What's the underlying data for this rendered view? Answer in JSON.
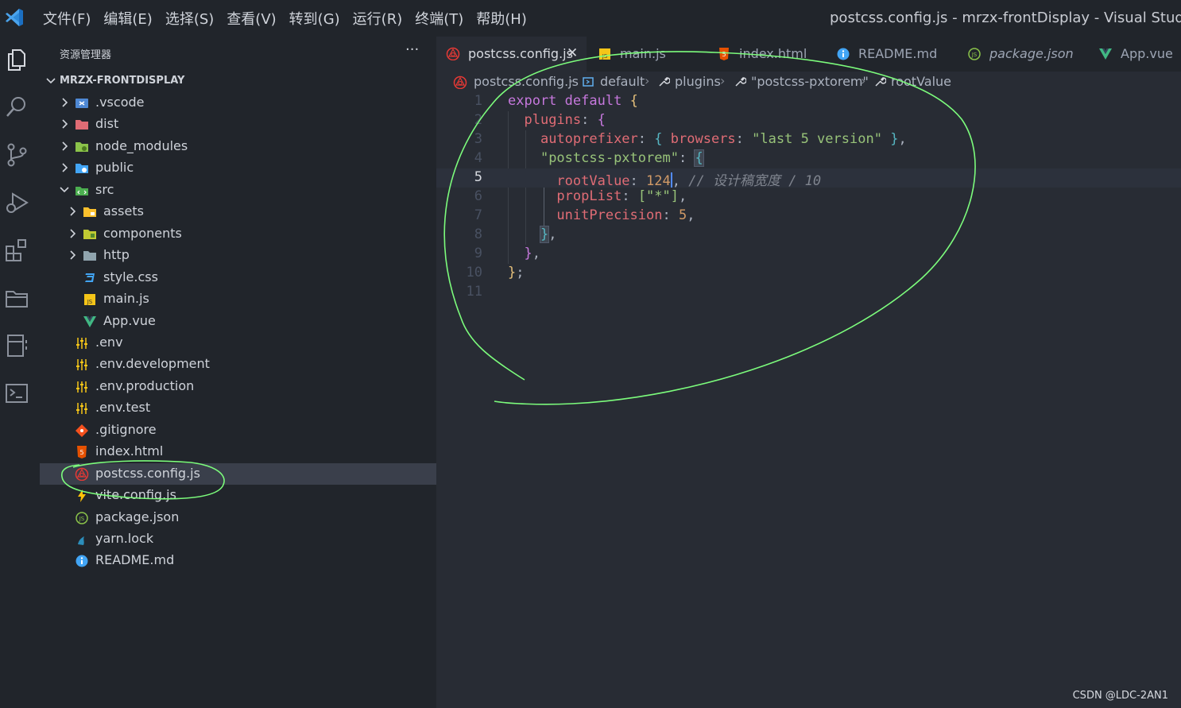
{
  "menu": [
    "文件(F)",
    "编辑(E)",
    "选择(S)",
    "查看(V)",
    "转到(G)",
    "运行(R)",
    "终端(T)",
    "帮助(H)"
  ],
  "window_title": "postcss.config.js - mrzx-frontDisplay - Visual Studio Code",
  "sidebar": {
    "title": "资源管理器",
    "more": "···",
    "project": "MRZX-FRONTDISPLAY",
    "tree": [
      {
        "label": ".vscode",
        "icon": "vscode-folder-icon",
        "depth": 1,
        "chevron": "right"
      },
      {
        "label": "dist",
        "icon": "dist-folder-icon",
        "depth": 1,
        "chevron": "right"
      },
      {
        "label": "node_modules",
        "icon": "node-folder-icon",
        "depth": 1,
        "chevron": "right"
      },
      {
        "label": "public",
        "icon": "public-folder-icon",
        "depth": 1,
        "chevron": "right"
      },
      {
        "label": "src",
        "icon": "src-folder-icon",
        "depth": 1,
        "chevron": "down"
      },
      {
        "label": "assets",
        "icon": "assets-folder-icon",
        "depth": 2,
        "chevron": "right"
      },
      {
        "label": "components",
        "icon": "components-folder-icon",
        "depth": 2,
        "chevron": "right"
      },
      {
        "label": "http",
        "icon": "folder-icon",
        "depth": 2,
        "chevron": "right"
      },
      {
        "label": "style.css",
        "icon": "css-file-icon",
        "depth": 2,
        "chevron": ""
      },
      {
        "label": "main.js",
        "icon": "js-file-icon",
        "depth": 2,
        "chevron": ""
      },
      {
        "label": "App.vue",
        "icon": "vue-file-icon",
        "depth": 2,
        "chevron": ""
      },
      {
        "label": ".env",
        "icon": "env-file-icon",
        "depth": 1,
        "chevron": ""
      },
      {
        "label": ".env.development",
        "icon": "env-file-icon",
        "depth": 1,
        "chevron": ""
      },
      {
        "label": ".env.production",
        "icon": "env-file-icon",
        "depth": 1,
        "chevron": ""
      },
      {
        "label": ".env.test",
        "icon": "env-file-icon",
        "depth": 1,
        "chevron": ""
      },
      {
        "label": ".gitignore",
        "icon": "git-file-icon",
        "depth": 1,
        "chevron": ""
      },
      {
        "label": "index.html",
        "icon": "html-file-icon",
        "depth": 1,
        "chevron": ""
      },
      {
        "label": "postcss.config.js",
        "icon": "postcss-file-icon",
        "depth": 1,
        "chevron": "",
        "selected": true
      },
      {
        "label": "vite.config.js",
        "icon": "vite-file-icon",
        "depth": 1,
        "chevron": ""
      },
      {
        "label": "package.json",
        "icon": "json-file-icon",
        "depth": 1,
        "chevron": ""
      },
      {
        "label": "yarn.lock",
        "icon": "yarn-file-icon",
        "depth": 1,
        "chevron": ""
      },
      {
        "label": "README.md",
        "icon": "info-file-icon",
        "depth": 1,
        "chevron": ""
      }
    ]
  },
  "tabs": [
    {
      "label": "postcss.config.js",
      "icon": "postcss-file-icon",
      "active": true,
      "close": "✕"
    },
    {
      "label": "main.js",
      "icon": "js-file-icon"
    },
    {
      "label": "index.html",
      "icon": "html-file-icon"
    },
    {
      "label": "README.md",
      "icon": "info-file-icon"
    },
    {
      "label": "package.json",
      "icon": "json-file-icon",
      "italic": true
    },
    {
      "label": "App.vue",
      "icon": "vue-file-icon"
    }
  ],
  "breadcrumb": [
    "postcss.config.js",
    "default",
    "plugins",
    "\"postcss-pxtorem\"",
    "rootValue"
  ],
  "code": {
    "line_numbers": [
      "1",
      "2",
      "3",
      "4",
      "5",
      "6",
      "7",
      "8",
      "9",
      "10",
      "11"
    ],
    "current_line": 5,
    "l1": [
      "export",
      "default",
      "{"
    ],
    "l2": [
      "plugins",
      ":",
      "{"
    ],
    "l3": [
      "autoprefixer",
      ":",
      "{",
      "browsers",
      ":",
      "\"last 5 version\"",
      "}",
      ","
    ],
    "l4": [
      "\"postcss-pxtorem\"",
      ":",
      "{"
    ],
    "l5": [
      "rootValue",
      ":",
      "124",
      ",",
      "// 设计稿宽度 / 10"
    ],
    "l6": [
      "propList",
      ":",
      "[\"*\"]",
      ","
    ],
    "l7": [
      "unitPrecision",
      ":",
      "5",
      ","
    ],
    "l8": [
      "}",
      ","
    ],
    "l9": [
      "}",
      ","
    ],
    "l10": [
      "}",
      ";"
    ]
  },
  "watermark": "CSDN @LDC-2AN1",
  "colors": {
    "annotation": "#7CFC7C",
    "keyword": "#c678dd",
    "property": "#e06c75",
    "string": "#98c379",
    "number": "#d19a66",
    "accent": "#528bff"
  }
}
